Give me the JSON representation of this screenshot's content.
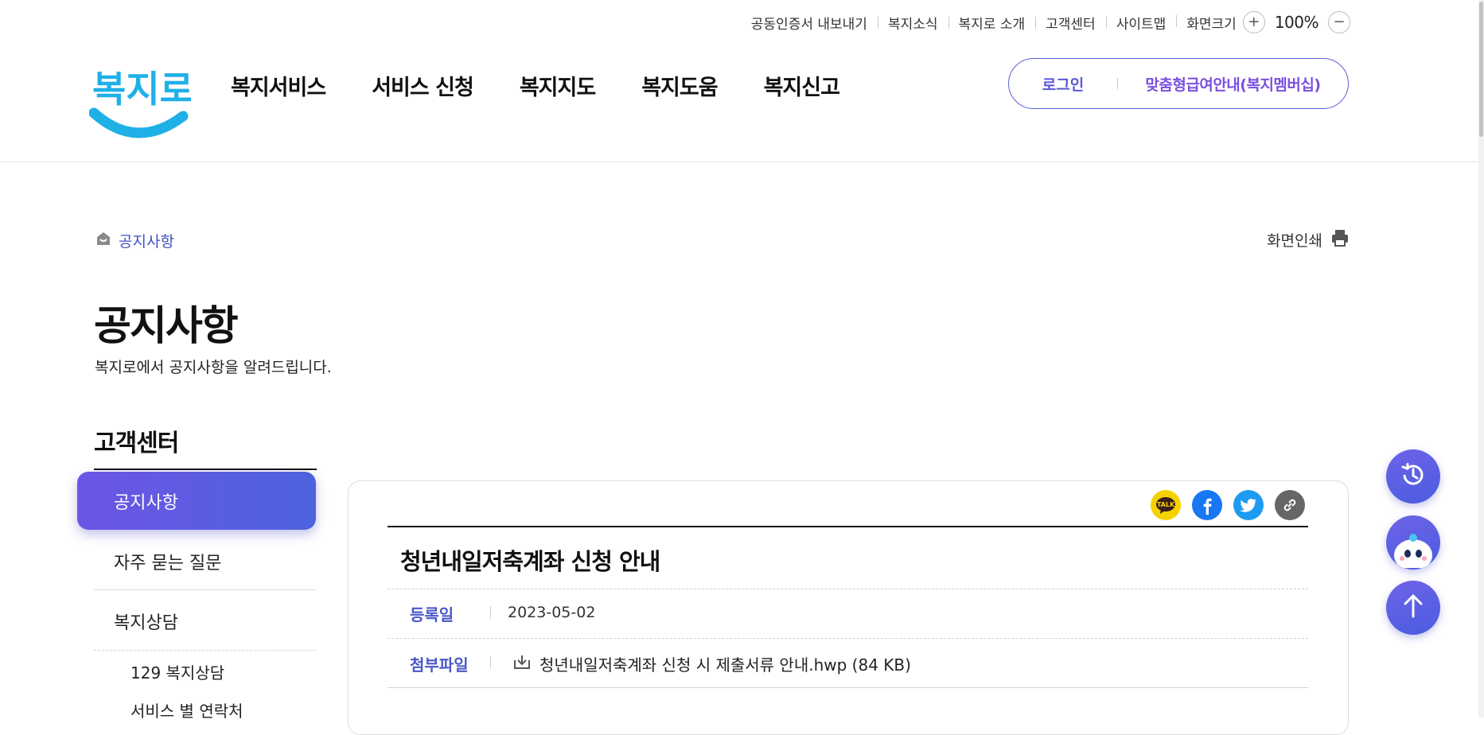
{
  "utility": {
    "links": [
      "공동인증서 내보내기",
      "복지소식",
      "복지로 소개",
      "고객센터",
      "사이트맵"
    ],
    "zoom_label": "화면크기",
    "zoom_in": "+",
    "zoom_value": "100%",
    "zoom_out": "−"
  },
  "logo": {
    "text": "복지로",
    "color": "#1fb0e8"
  },
  "gnb": [
    "복지서비스",
    "서비스 신청",
    "복지지도",
    "복지도움",
    "복지신고"
  ],
  "account": {
    "login": "로그인",
    "membership": "맞춤형급여안내(복지멤버십)"
  },
  "breadcrumb": {
    "current": "공지사항"
  },
  "print_label": "화면인쇄",
  "page": {
    "title": "공지사항",
    "subtitle": "복지로에서 공지사항을 알려드립니다."
  },
  "lnb": {
    "title": "고객센터",
    "active": "공지사항",
    "items": [
      "자주 묻는 질문",
      "복지상담"
    ],
    "sub_items": [
      "129 복지상담",
      "서비스 별 연락처"
    ]
  },
  "share": [
    "kakao-talk",
    "facebook",
    "twitter",
    "copy-link"
  ],
  "post": {
    "title": "청년내일저축계좌 신청 안내",
    "date_label": "등록일",
    "date": "2023-05-02",
    "attach_label": "첨부파일",
    "attachment": "청년내일저축계좌 신청 시 제출서류 안내.hwp (84 KB)"
  },
  "colors": {
    "accent": "#5b57d9",
    "label": "#4a57c8",
    "logo": "#1fb0e8"
  }
}
